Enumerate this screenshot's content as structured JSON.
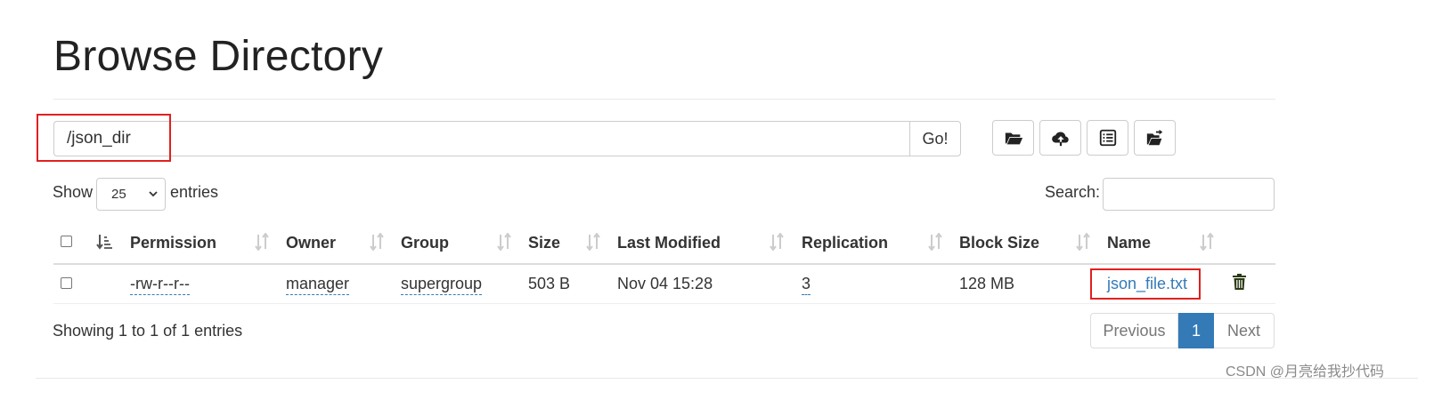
{
  "page": {
    "title": "Browse Directory"
  },
  "path_bar": {
    "value": "/json_dir",
    "go_label": "Go!"
  },
  "toolbar": {
    "buttons": [
      {
        "icon": "folder-open-icon"
      },
      {
        "icon": "cloud-upload-icon"
      },
      {
        "icon": "list-alt-icon"
      },
      {
        "icon": "folder-move-icon"
      }
    ]
  },
  "length_menu": {
    "show_label": "Show",
    "selected": "25",
    "entries_label": "entries"
  },
  "search": {
    "label": "Search:",
    "value": ""
  },
  "table": {
    "columns": [
      "Permission",
      "Owner",
      "Group",
      "Size",
      "Last Modified",
      "Replication",
      "Block Size",
      "Name"
    ],
    "rows": [
      {
        "permission": "-rw-r--r--",
        "owner": "manager",
        "group": "supergroup",
        "size": "503 B",
        "last_modified": "Nov 04 15:28",
        "replication": "3",
        "block_size": "128 MB",
        "name": "json_file.txt"
      }
    ]
  },
  "footer": {
    "info": "Showing 1 to 1 of 1 entries",
    "previous_label": "Previous",
    "current_page": "1",
    "next_label": "Next"
  },
  "watermark": "CSDN @月亮给我抄代码",
  "colors": {
    "link": "#337ab7",
    "active_page": "#337ab7",
    "highlight": "#e0201f",
    "trash": "#2b3a14"
  }
}
